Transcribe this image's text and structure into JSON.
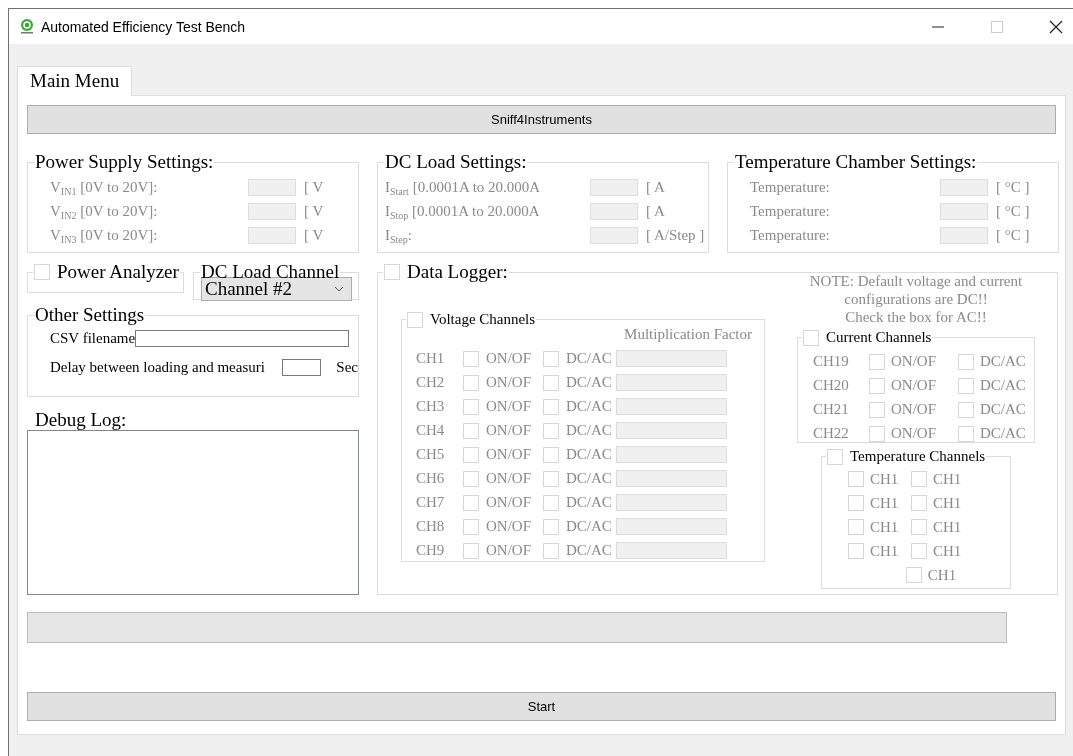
{
  "window": {
    "title": "Automated Efficiency Test Bench"
  },
  "tabs": [
    {
      "label": "Main Menu",
      "selected": true
    }
  ],
  "sniff_button": "Sniff4Instruments",
  "power_supply": {
    "title": "Power Supply Settings:",
    "disabled": true,
    "rows": [
      {
        "label": "V$_{IN1}$ [0V to 20V]:",
        "unit": "[ V"
      },
      {
        "label": "V$_{IN2}$ [0V to 20V]:",
        "unit": "[ V"
      },
      {
        "label": "V$_{IN3}$ [0V to 20V]:",
        "unit": "[ V"
      }
    ]
  },
  "dc_load": {
    "title": "DC Load Settings:",
    "disabled": true,
    "rows": [
      {
        "label": "I$_{Start}$ [0.0001A to 20.000A",
        "unit": "[ A"
      },
      {
        "label": "I$_{Stop}$ [0.0001A to 20.000A",
        "unit": "[ A"
      },
      {
        "label": "I$_{Step}$:",
        "unit": "[ A/Step ]"
      }
    ]
  },
  "temp_chamber": {
    "title": "Temperature Chamber Settings:",
    "disabled": true,
    "rows": [
      {
        "label": "Temperature:",
        "unit": "[ °C ]"
      },
      {
        "label": "Temperature:",
        "unit": "[ °C ]"
      },
      {
        "label": "Temperature:",
        "unit": "[ °C ]"
      }
    ]
  },
  "power_analyzer": {
    "label": "Power Analyzer",
    "checked": false
  },
  "dc_load_channel": {
    "title": "DC Load Channel",
    "value": "Channel #2"
  },
  "other_settings": {
    "title": "Other Settings",
    "fields": [
      {
        "label": "CSV filename",
        "kind": "wide"
      },
      {
        "label": "Delay between loading and measuri",
        "kind": "short",
        "unit": "Sec"
      }
    ]
  },
  "debug_log": {
    "title": "Debug Log:"
  },
  "data_logger": {
    "label": "Data Logger:",
    "checked": false,
    "note_lines": [
      "NOTE: Default voltage and current",
      "configurations are DC!!",
      "Check the box for AC!!"
    ]
  },
  "voltage_channels": {
    "label": "Voltage Channels",
    "checked": false,
    "disabled": true,
    "factor_header": "Multiplication Factor",
    "rows": [
      {
        "name": "CH1",
        "on_label": "ON/OF",
        "on": false,
        "mode_label": "DC/AC",
        "ac": false
      },
      {
        "name": "CH2",
        "on_label": "ON/OF",
        "on": false,
        "mode_label": "DC/AC",
        "ac": false
      },
      {
        "name": "CH3",
        "on_label": "ON/OF",
        "on": false,
        "mode_label": "DC/AC",
        "ac": false
      },
      {
        "name": "CH4",
        "on_label": "ON/OF",
        "on": false,
        "mode_label": "DC/AC",
        "ac": false
      },
      {
        "name": "CH5",
        "on_label": "ON/OF",
        "on": false,
        "mode_label": "DC/AC",
        "ac": false
      },
      {
        "name": "CH6",
        "on_label": "ON/OF",
        "on": false,
        "mode_label": "DC/AC",
        "ac": false
      },
      {
        "name": "CH7",
        "on_label": "ON/OF",
        "on": false,
        "mode_label": "DC/AC",
        "ac": false
      },
      {
        "name": "CH8",
        "on_label": "ON/OF",
        "on": false,
        "mode_label": "DC/AC",
        "ac": false
      },
      {
        "name": "CH9",
        "on_label": "ON/OF",
        "on": false,
        "mode_label": "DC/AC",
        "ac": false
      }
    ]
  },
  "current_channels": {
    "label": "Current Channels",
    "checked": false,
    "disabled": true,
    "rows": [
      {
        "name": "CH19",
        "on_label": "ON/OF",
        "on": false,
        "mode_label": "DC/AC",
        "ac": false
      },
      {
        "name": "CH20",
        "on_label": "ON/OF",
        "on": false,
        "mode_label": "DC/AC",
        "ac": false
      },
      {
        "name": "CH21",
        "on_label": "ON/OF",
        "on": false,
        "mode_label": "DC/AC",
        "ac": false
      },
      {
        "name": "CH22",
        "on_label": "ON/OF",
        "on": false,
        "mode_label": "DC/AC",
        "ac": false
      }
    ]
  },
  "temperature_channels": {
    "label": "Temperature Channels",
    "checked": false,
    "disabled": true,
    "channels": [
      {
        "name": "CH1",
        "checked": false
      },
      {
        "name": "CH1",
        "checked": false
      },
      {
        "name": "CH1",
        "checked": false
      },
      {
        "name": "CH1",
        "checked": false
      },
      {
        "name": "CH1",
        "checked": false
      },
      {
        "name": "CH1",
        "checked": false
      },
      {
        "name": "CH1",
        "checked": false
      },
      {
        "name": "CH1",
        "checked": false
      },
      {
        "name": "CH1",
        "checked": false
      }
    ]
  },
  "progress": {
    "level": 0
  },
  "start_button": "Start"
}
